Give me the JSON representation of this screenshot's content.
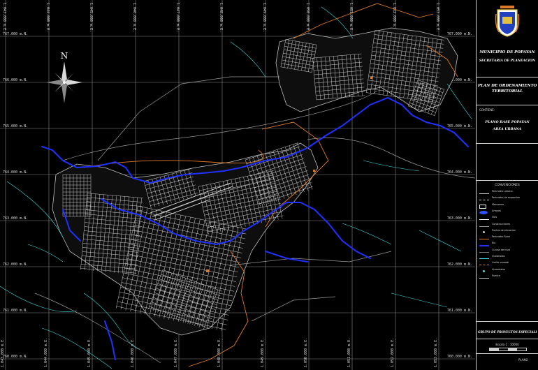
{
  "map": {
    "grid_lines_color": "#8a8a8a",
    "river_color": "#2030ff",
    "stream_color": "#40e0e0",
    "urban_color": "#e8e8e8",
    "boundary_color": "#e07a28",
    "easting_labels_top": [
      "1.043.000 m.E.",
      "1.044.000 m.E.",
      "1.045.000 m.E.",
      "1.046.000 m.E.",
      "1.047.000 m.E.",
      "1.048.000 m.E.",
      "1.049.000 m.E.",
      "1.050.000 m.E.",
      "1.051.000 m.E.",
      "1.052.000 m.E.",
      "1.053.000 m.E."
    ],
    "easting_labels_bottom": [
      "1.043.000 m.E.",
      "1.044.000 m.E.",
      "1.045.000 m.E.",
      "1.046.000 m.E.",
      "1.047.000 m.E.",
      "1.048.000 m.E.",
      "1.049.000 m.E.",
      "1.050.000 m.E.",
      "1.051.000 m.E.",
      "1.052.000 m.E.",
      "1.053.000 m.E."
    ],
    "northing_labels_left": [
      "767.000 m.N.",
      "766.000 m.N.",
      "765.000 m.N.",
      "764.000 m.N.",
      "763.000 m.N.",
      "762.000 m.N.",
      "761.000 m.N.",
      "760.000 m.N."
    ],
    "northing_labels_right": [
      "767.000 m.N.",
      "766.000 m.N.",
      "765.000 m.N.",
      "764.000 m.N.",
      "763.000 m.N.",
      "762.000 m.N.",
      "761.000 m.N.",
      "760.000 m.N."
    ],
    "north_label": "N",
    "north_arrow_icon": "compass-rose-icon",
    "coat_of_arms_icon": "coat-of-arms-icon"
  },
  "panel": {
    "title": "MUNICIPIO DE POPAYAN",
    "subtitle": "SECRETARIA DE PLANEACION",
    "plan_title_1": "PLAN DE ORDENAMIENTO",
    "plan_title_2": "TERRITORIAL",
    "contains_label": "CONTIENE:",
    "content_1": "PLANO BASE POPAYAN",
    "content_2": "AREA URBANA",
    "legend_title": "CONVENCIONES",
    "legend": [
      {
        "label": "Perimetro urbano",
        "sym": "line",
        "color": "#cfcfcf"
      },
      {
        "label": "Perimetro de expansion",
        "sym": "dash",
        "color": "#cfcfcf"
      },
      {
        "label": "Manzanas",
        "sym": "box",
        "color": "#e8e8e8"
      },
      {
        "label": "Arroyos",
        "sym": "blob",
        "color": "#3050ff"
      },
      {
        "label": "Vias",
        "sym": "line",
        "color": "#ffffff"
      },
      {
        "label": "Construcciones",
        "sym": "line",
        "color": "#9a9a9a"
      },
      {
        "label": "Puntos de elevacion",
        "sym": "dot",
        "color": "#cfcfcf"
      },
      {
        "label": "Perimetro Rural",
        "sym": "line",
        "color": "#e07a28"
      },
      {
        "label": "Rio",
        "sym": "thick",
        "color": "#2030ff"
      },
      {
        "label": "Curvas de nivel",
        "sym": "line",
        "color": "#7a7a7a"
      },
      {
        "label": "Quebradas",
        "sym": "line",
        "color": "#40e0e0"
      },
      {
        "label": "Limite veredal",
        "sym": "dash",
        "color": "#e07a28"
      },
      {
        "label": "Humedales",
        "sym": "dot",
        "color": "#40e0e0"
      },
      {
        "label": "Puente",
        "sym": "line",
        "color": "#cfcfcf"
      }
    ],
    "footer_1": "GRUPO DE PROYECTOS ESPECIALES",
    "scale_label": "Escala 1 : 10000",
    "sheet_label": "PLANO"
  }
}
